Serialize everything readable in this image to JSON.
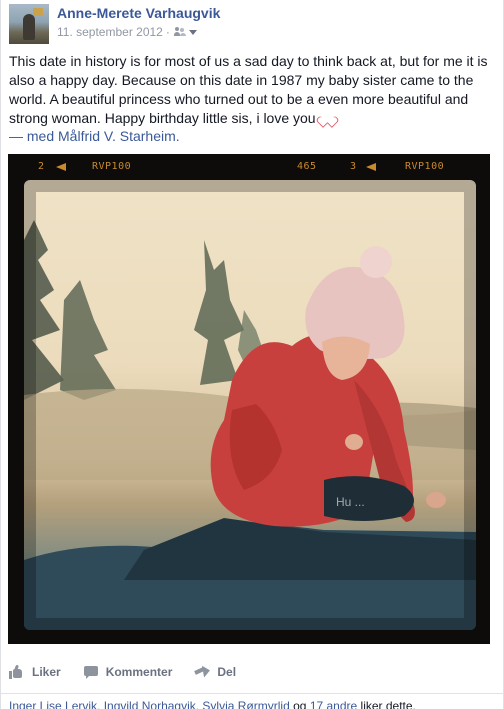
{
  "post": {
    "author": "Anne-Merete Varhaugvik",
    "date": "11. september 2012",
    "separator": "·",
    "audience_icon": "friends-icon",
    "body": "This date in history is for most of us a sad day to think back at, but for me it is also a happy day. Because on this date in 1987 my baby sister came to the world. A beautiful princess who turned out to be a even more beautiful and strong woman. Happy birthday little sis, i love you",
    "with_prefix": "— med",
    "with_name": "Målfrid V. Starheim",
    "with_suffix": "."
  },
  "photo": {
    "film_labels": [
      "2",
      "RVP100",
      "465",
      "3",
      "RVP100"
    ]
  },
  "actions": {
    "like": "Liker",
    "comment": "Kommenter",
    "share": "Del"
  },
  "likes": {
    "names": "Inger Lise Lervik, Ingvild Norhagvik, Sylvia Rørmyrlid",
    "joiner": "og",
    "others": "17 andre",
    "suffix": "liker dette."
  },
  "colors": {
    "link": "#3b5998",
    "meta": "#9197a3",
    "action": "#6a7180",
    "film_text": "#c98a2e"
  }
}
